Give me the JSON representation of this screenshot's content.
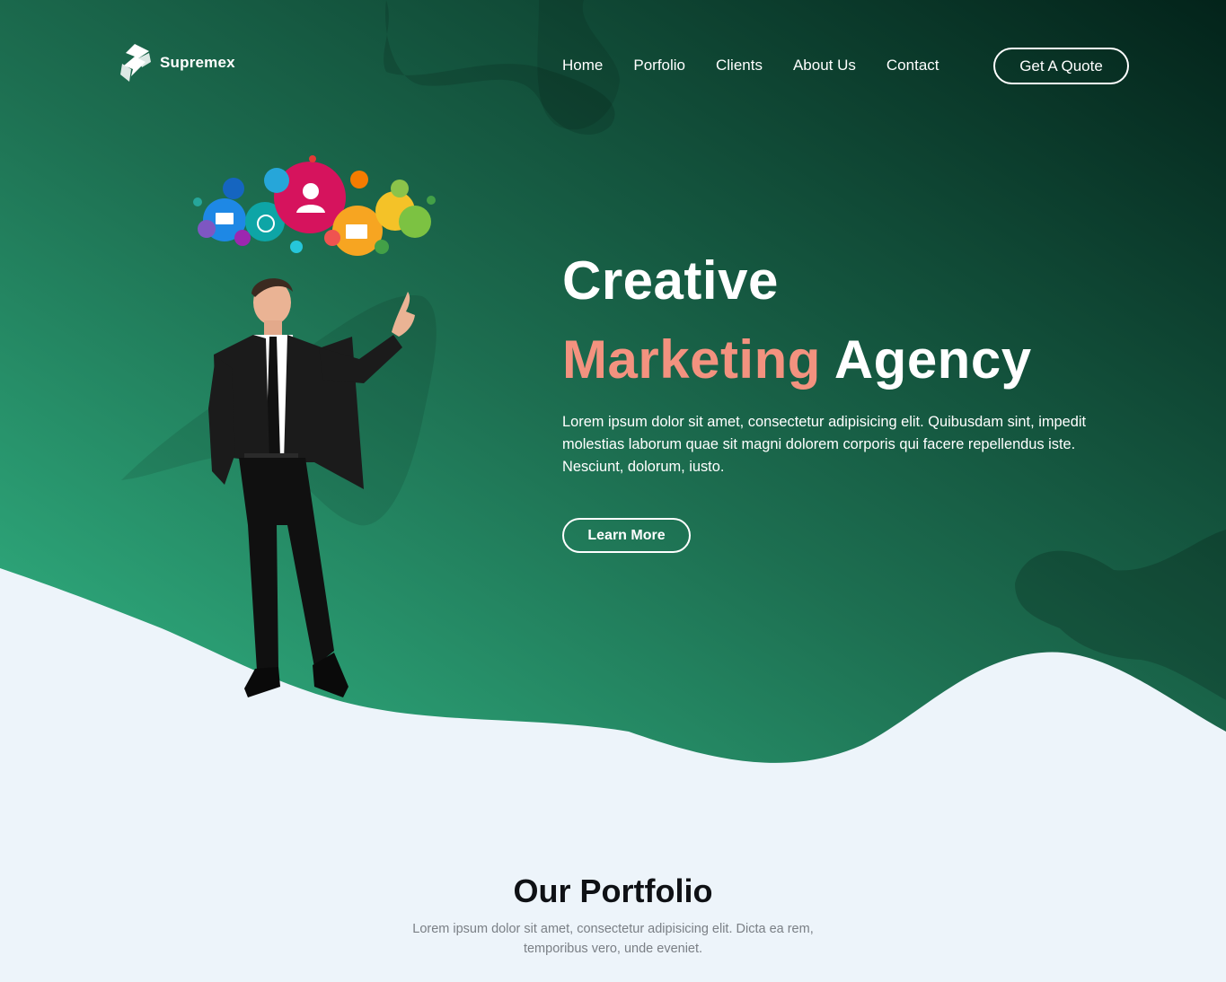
{
  "brand": {
    "name": "Supremex",
    "logo_icon": "s-logo-icon"
  },
  "nav": {
    "items": [
      {
        "label": "Home"
      },
      {
        "label": "Porfolio"
      },
      {
        "label": "Clients"
      },
      {
        "label": "About Us"
      },
      {
        "label": "Contact"
      }
    ],
    "cta_label": "Get A Quote"
  },
  "hero": {
    "title_line1": "Creative",
    "title_accent": "Marketing",
    "title_rest": " Agency",
    "description": "Lorem ipsum dolor sit amet, consectetur adipisicing elit. Quibusdam sint, impedit molestias laborum quae sit magni dolorem corporis qui facere repellendus iste. Nesciunt, dolorum, iusto.",
    "button_label": "Learn More",
    "illustration": "businessman-pointing-social-media-cloud"
  },
  "portfolio": {
    "title": "Our Portfolio",
    "description": "Lorem ipsum dolor sit amet, consectetur adipisicing elit. Dicta ea rem, temporibus vero, unde eveniet."
  },
  "colors": {
    "hero_green_light": "#2fb382",
    "hero_green_mid": "#1d6e50",
    "hero_green_dark": "#03231a",
    "accent": "#f3927f",
    "page_bg": "#edf4fa"
  }
}
